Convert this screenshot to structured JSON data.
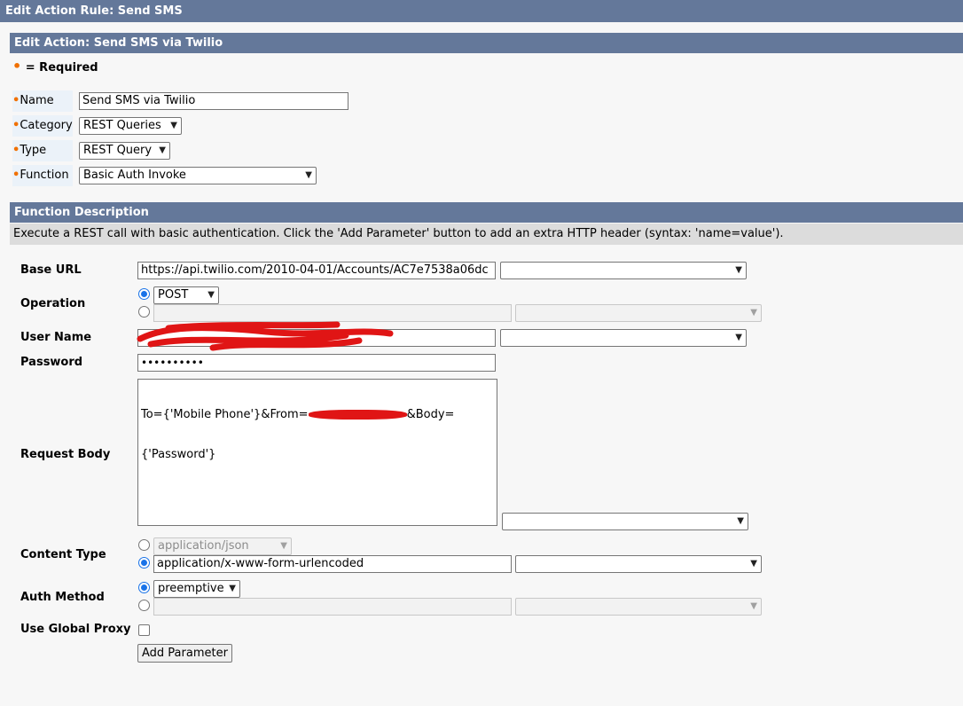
{
  "window": {
    "title": "Edit Action Rule: Send SMS"
  },
  "section": {
    "title": "Edit Action: Send SMS via Twilio"
  },
  "required_legend": {
    "dot": "•",
    "text": "= Required"
  },
  "fields": {
    "name": {
      "label": "Name",
      "value": "Send SMS via Twilio"
    },
    "category": {
      "label": "Category",
      "value": "REST Queries"
    },
    "type": {
      "label": "Type",
      "value": "REST Query"
    },
    "function": {
      "label": "Function",
      "value": "Basic Auth Invoke"
    }
  },
  "function_description": {
    "title": "Function Description",
    "text": "Execute a REST call with basic authentication. Click the 'Add Parameter' button to add an extra HTTP header (syntax: 'name=value')."
  },
  "params": {
    "base_url": {
      "label": "Base URL",
      "value": "https://api.twilio.com/2010-04-01/Accounts/AC7e7538a06dc",
      "selected": ""
    },
    "operation": {
      "label": "Operation",
      "selected": "POST",
      "custom_value": "",
      "custom_select": ""
    },
    "user_name": {
      "label": "User Name",
      "value": "",
      "selected": ""
    },
    "password": {
      "label": "Password",
      "value": "••••••••••"
    },
    "request_body": {
      "label": "Request Body",
      "value_part1": "To={'Mobile Phone'}&From=",
      "value_part2": "&Body=",
      "value_line2": "{'Password'}",
      "selected": ""
    },
    "content_type": {
      "label": "Content Type",
      "option_select": "application/json",
      "custom_value": "application/x-www-form-urlencoded",
      "custom_select": ""
    },
    "auth_method": {
      "label": "Auth Method",
      "selected": "preemptive",
      "custom_value": "",
      "custom_select": ""
    },
    "global_proxy": {
      "label": "Use Global Proxy",
      "checked": false
    }
  },
  "buttons": {
    "add_parameter": "Add Parameter"
  },
  "icons": {
    "dropdown": "chevron-down-icon",
    "required": "required-dot-icon"
  },
  "colors": {
    "header_bar": "#64789a",
    "required_dot": "#f07000",
    "radio_selected": "#1a73e8",
    "redaction": "#e01515"
  }
}
